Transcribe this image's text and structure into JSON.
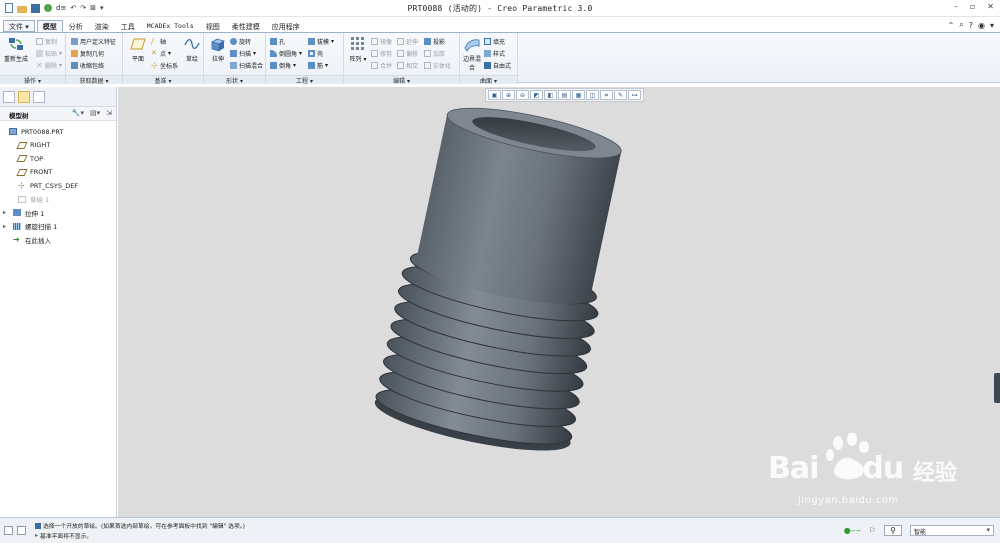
{
  "window": {
    "title": "PRT0088 (活动的) - Creo Parametric 3.0",
    "qat_label": "d≡"
  },
  "tabs": [
    "文件",
    "模型",
    "分析",
    "渲染",
    "工具",
    "MCADEx Tools",
    "视图",
    "柔性建模",
    "应用程序"
  ],
  "ribbon": {
    "operations": {
      "label": "操作",
      "regen": "重新生成",
      "copy": "复制",
      "paste": "粘贴",
      "delete": "删除"
    },
    "get_data": {
      "label": "获取数据",
      "udf": "用户定义特征",
      "copy_geom": "复制几何",
      "shrinkwrap": "收缩包络"
    },
    "datum": {
      "label": "基准",
      "plane": "平面",
      "axis": "轴",
      "point": "点",
      "csys": "坐标系",
      "sketch": "草绘"
    },
    "shapes": {
      "label": "形状",
      "extrude": "拉伸",
      "revolve": "旋转",
      "sweep": "扫描",
      "swept_blend": "扫描混合"
    },
    "engineering": {
      "label": "工程",
      "hole": "孔",
      "round": "倒圆角",
      "chamfer": "倒角",
      "draft": "拔模",
      "shell": "壳",
      "rib": "筋"
    },
    "pattern": {
      "label": "阵列"
    },
    "editing": {
      "label": "编辑",
      "mirror": "镜像",
      "extend": "延伸",
      "project": "投影",
      "trim": "修剪",
      "offset": "偏移",
      "thicken": "加厚",
      "merge": "合并",
      "intersect": "相交",
      "solidify": "实体化"
    },
    "surfaces": {
      "label": "曲面",
      "boundary": "边界混合",
      "fill": "填充",
      "style": "样式",
      "freestyle": "自由式"
    }
  },
  "sidebar": {
    "header": "模型树",
    "tree": [
      {
        "label": "PRT0088.PRT",
        "icon": "part-icon"
      },
      {
        "label": "RIGHT",
        "icon": "datum-plane-icon"
      },
      {
        "label": "TOP",
        "icon": "datum-plane-icon"
      },
      {
        "label": "FRONT",
        "icon": "datum-plane-icon"
      },
      {
        "label": "PRT_CSYS_DEF",
        "icon": "csys-icon"
      },
      {
        "label": "草绘 1",
        "icon": "sketch-icon"
      },
      {
        "label": "拉伸 1",
        "icon": "extrude-icon"
      },
      {
        "label": "螺旋扫描 1",
        "icon": "helical-sweep-icon"
      },
      {
        "label": "在此插入",
        "icon": "insert-here-icon"
      }
    ]
  },
  "status": {
    "message1": "选择一个开放的草绘。(如果首选内部草绘，可在参考面板中找到 \"编辑\" 选项。)",
    "message2": "基准平面将不显示。",
    "filter": "智能"
  },
  "watermark": {
    "brand": "Bai",
    "brand2": "du",
    "jingyan": "经验",
    "url": "jingyan.baidu.com"
  },
  "colors": {
    "accent": "#3a6ea5",
    "ribbon_border": "#9bb1cc",
    "viewport_bg": "#dcdcdc",
    "model_gray": "#6f7780"
  }
}
